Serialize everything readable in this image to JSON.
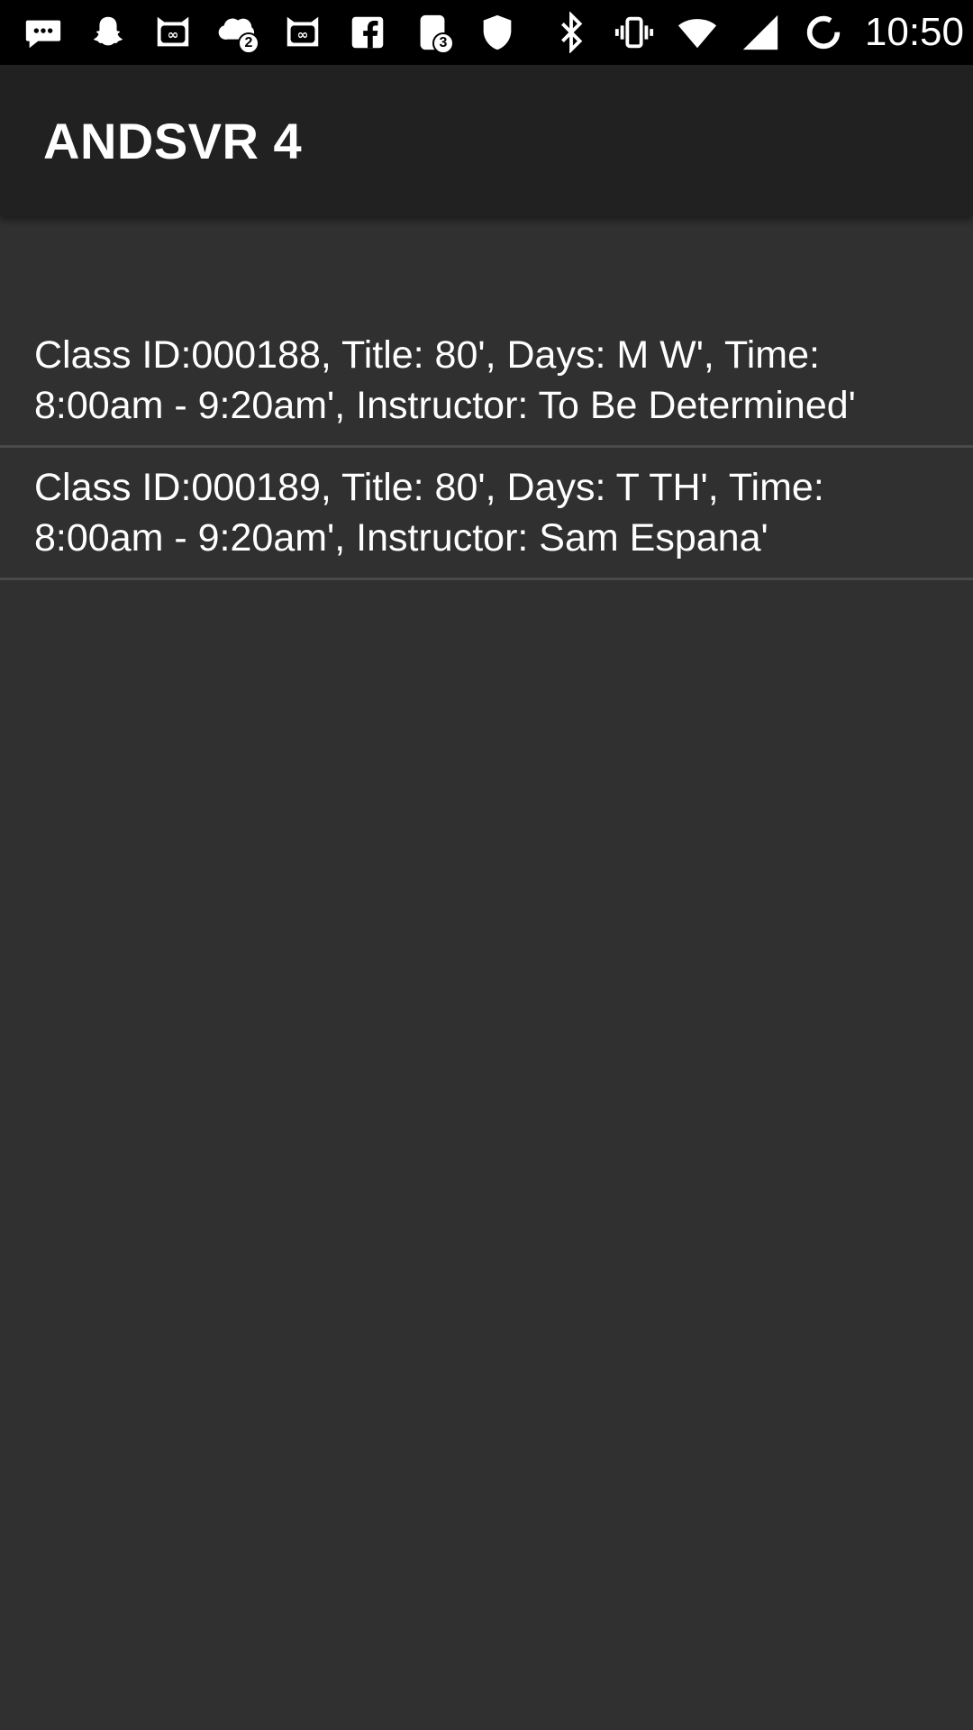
{
  "status_bar": {
    "left_icons": [
      {
        "name": "messages-icon",
        "badge": ""
      },
      {
        "name": "snapchat-icon",
        "badge": ""
      },
      {
        "name": "app-infinity-icon",
        "badge": "∞"
      },
      {
        "name": "chat-bubble-icon",
        "badge": "2"
      },
      {
        "name": "app-infinity-icon-2",
        "badge": "∞"
      },
      {
        "name": "facebook-icon",
        "badge": ""
      },
      {
        "name": "app-3-icon",
        "badge": "3"
      },
      {
        "name": "shield-icon",
        "badge": ""
      }
    ],
    "right_icons": [
      "bluetooth-icon",
      "vibrate-icon",
      "wifi-icon",
      "cell-signal-icon",
      "battery-charging-icon"
    ],
    "time": "10:50"
  },
  "app_bar": {
    "title": "ANDSVR 4"
  },
  "classes": [
    {
      "text": "Class ID:000188, Title: 80', Days: M W', Time: 8:00am - 9:20am', Instructor: To Be Determined'"
    },
    {
      "text": "Class ID:000189, Title: 80', Days: T TH', Time: 8:00am - 9:20am', Instructor: Sam Espana'"
    }
  ],
  "colors": {
    "status_bar": "#000000",
    "app_bar": "#212121",
    "background": "#303030",
    "divider": "#4a4a4a",
    "text": "#ffffff"
  }
}
